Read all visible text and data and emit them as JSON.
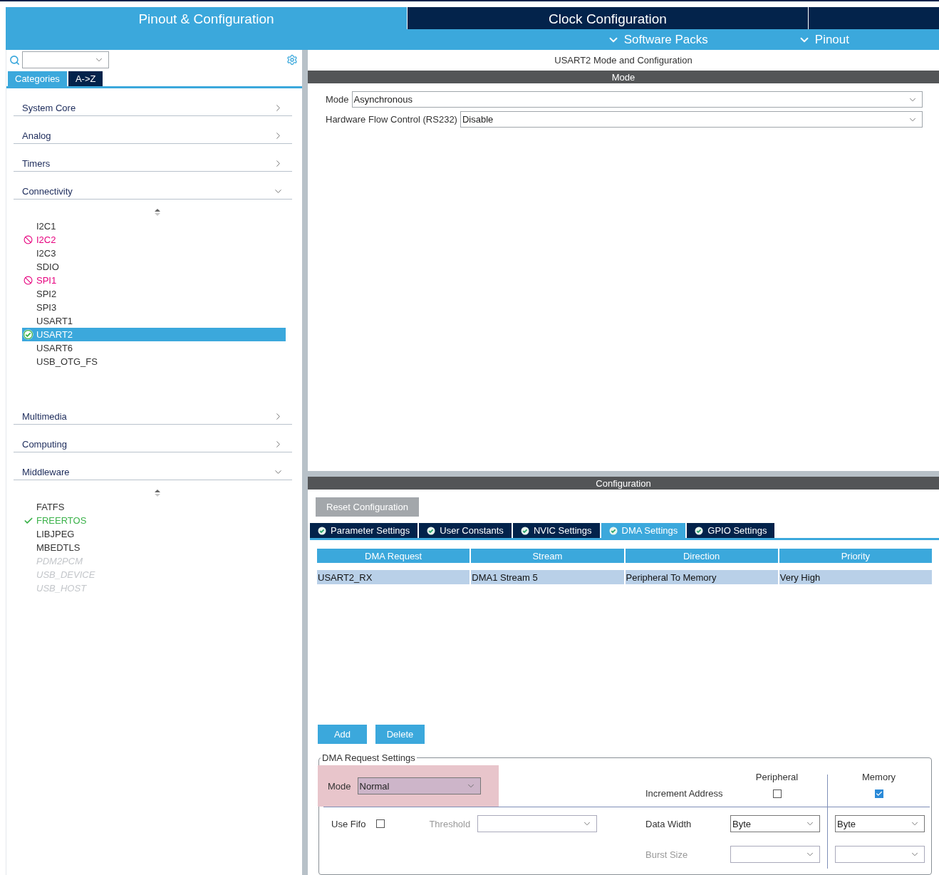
{
  "header": {
    "tabs": [
      {
        "label": "Pinout & Configuration",
        "selected": true
      },
      {
        "label": "Clock Configuration",
        "selected": false
      }
    ],
    "submenu": [
      {
        "label": "Software Packs"
      },
      {
        "label": "Pinout"
      }
    ]
  },
  "sidebar": {
    "view_tabs": [
      {
        "label": "Categories",
        "selected": true
      },
      {
        "label": "A->Z",
        "selected": false
      }
    ],
    "categories": [
      {
        "label": "System Core",
        "expanded": false
      },
      {
        "label": "Analog",
        "expanded": false
      },
      {
        "label": "Timers",
        "expanded": false
      },
      {
        "label": "Connectivity",
        "expanded": true,
        "items": [
          {
            "label": "I2C1",
            "kind": "none",
            "selected": false
          },
          {
            "label": "I2C2",
            "kind": "conflict",
            "selected": false
          },
          {
            "label": "I2C3",
            "kind": "none",
            "selected": false
          },
          {
            "label": "SDIO",
            "kind": "none",
            "selected": false
          },
          {
            "label": "SPI1",
            "kind": "conflict",
            "selected": false
          },
          {
            "label": "SPI2",
            "kind": "none",
            "selected": false
          },
          {
            "label": "SPI3",
            "kind": "none",
            "selected": false
          },
          {
            "label": "USART1",
            "kind": "none",
            "selected": false
          },
          {
            "label": "USART2",
            "kind": "configured",
            "selected": true
          },
          {
            "label": "USART6",
            "kind": "none",
            "selected": false
          },
          {
            "label": "USB_OTG_FS",
            "kind": "none",
            "selected": false
          }
        ]
      },
      {
        "label": "Multimedia",
        "expanded": false
      },
      {
        "label": "Computing",
        "expanded": false
      },
      {
        "label": "Middleware",
        "expanded": true,
        "items": [
          {
            "label": "FATFS",
            "kind": "none",
            "selected": false
          },
          {
            "label": "FREERTOS",
            "kind": "enabled",
            "selected": false
          },
          {
            "label": "LIBJPEG",
            "kind": "none",
            "selected": false
          },
          {
            "label": "MBEDTLS",
            "kind": "none",
            "selected": false
          },
          {
            "label": "PDM2PCM",
            "kind": "unavailable",
            "selected": false
          },
          {
            "label": "USB_DEVICE",
            "kind": "unavailable",
            "selected": false
          },
          {
            "label": "USB_HOST",
            "kind": "unavailable",
            "selected": false
          }
        ]
      }
    ]
  },
  "mode_panel": {
    "title": "USART2 Mode and Configuration",
    "header": "Mode",
    "fields": [
      {
        "label": "Mode",
        "value": "Asynchronous"
      },
      {
        "label": "Hardware Flow Control (RS232)",
        "value": "Disable"
      }
    ]
  },
  "configuration": {
    "header": "Configuration",
    "reset_button": "Reset Configuration",
    "tabs": [
      {
        "label": "Parameter Settings",
        "selected": false
      },
      {
        "label": "User Constants",
        "selected": false
      },
      {
        "label": "NVIC Settings",
        "selected": false
      },
      {
        "label": "DMA Settings",
        "selected": true
      },
      {
        "label": "GPIO Settings",
        "selected": false
      }
    ],
    "table": {
      "columns": [
        "DMA Request",
        "Stream",
        "Direction",
        "Priority"
      ],
      "rows": [
        {
          "cells": [
            "USART2_RX",
            "DMA1 Stream 5",
            "Peripheral To Memory",
            "Very High"
          ],
          "selected": true
        }
      ]
    },
    "buttons": [
      "Add",
      "Delete"
    ],
    "dma_request_settings": {
      "title": "DMA Request Settings",
      "mode": {
        "label": "Mode",
        "value": "Normal",
        "highlighted": true
      },
      "column_headers": [
        "Peripheral",
        "Memory"
      ],
      "increment_address": {
        "label": "Increment Address",
        "peripheral": false,
        "memory": true
      },
      "use_fifo": {
        "label": "Use Fifo",
        "checked": false
      },
      "threshold": {
        "label": "Threshold",
        "disabled": true
      },
      "data_width": {
        "label": "Data Width",
        "disabled": false,
        "peripheral": "Byte",
        "memory": "Byte"
      },
      "burst_size": {
        "label": "Burst Size",
        "disabled": true
      }
    }
  }
}
